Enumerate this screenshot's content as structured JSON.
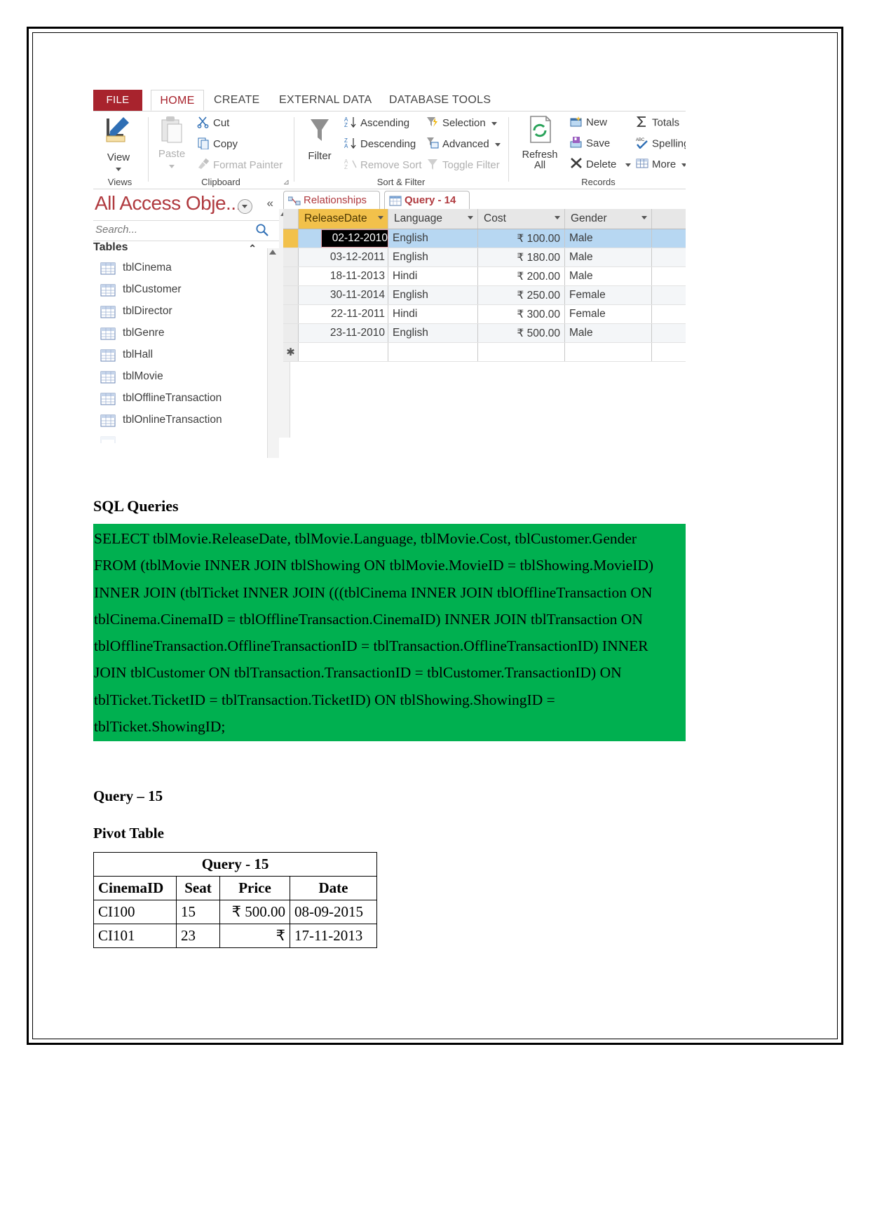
{
  "access": {
    "tabs": [
      {
        "id": "file",
        "label": "FILE"
      },
      {
        "id": "home",
        "label": "HOME"
      },
      {
        "id": "create",
        "label": "CREATE"
      },
      {
        "id": "external",
        "label": "EXTERNAL DATA"
      },
      {
        "id": "dbtools",
        "label": "DATABASE TOOLS"
      }
    ],
    "ribbon": {
      "views": {
        "group_label": "Views",
        "view_label": "View"
      },
      "clipboard": {
        "group_label": "Clipboard",
        "paste_label": "Paste",
        "cut_label": "Cut",
        "copy_label": "Copy",
        "format_painter_label": "Format Painter"
      },
      "sort_filter": {
        "group_label": "Sort & Filter",
        "filter_label": "Filter",
        "ascending_label": "Ascending",
        "descending_label": "Descending",
        "remove_sort_label": "Remove Sort",
        "selection_label": "Selection",
        "advanced_label": "Advanced",
        "toggle_filter_label": "Toggle Filter"
      },
      "records": {
        "group_label": "Records",
        "refresh_all_label": "Refresh All",
        "new_label": "New",
        "save_label": "Save",
        "delete_label": "Delete",
        "totals_label": "Totals",
        "spelling_label": "Spelling",
        "more_label": "More"
      }
    },
    "navpane": {
      "title": "All Access Obje...",
      "search_placeholder": "Search...",
      "section_label": "Tables",
      "tables": [
        "tblCinema",
        "tblCustomer",
        "tblDirector",
        "tblGenre",
        "tblHall",
        "tblMovie",
        "tblOfflineTransaction",
        "tblOnlineTransaction"
      ]
    },
    "doc_tabs": [
      {
        "id": "relationships",
        "label": "Relationships",
        "active": false
      },
      {
        "id": "query14",
        "label": "Query - 14",
        "active": true
      }
    ],
    "datasheet": {
      "columns": [
        "ReleaseDate",
        "Language",
        "Cost",
        "Gender"
      ],
      "rows": [
        {
          "ReleaseDate": "02-12-2010",
          "Language": "English",
          "Cost": "₹ 100.00",
          "Gender": "Male"
        },
        {
          "ReleaseDate": "03-12-2011",
          "Language": "English",
          "Cost": "₹ 180.00",
          "Gender": "Male"
        },
        {
          "ReleaseDate": "18-11-2013",
          "Language": "Hindi",
          "Cost": "₹ 200.00",
          "Gender": "Male"
        },
        {
          "ReleaseDate": "30-11-2014",
          "Language": "English",
          "Cost": "₹ 250.00",
          "Gender": "Female"
        },
        {
          "ReleaseDate": "22-11-2011",
          "Language": "Hindi",
          "Cost": "₹ 300.00",
          "Gender": "Female"
        },
        {
          "ReleaseDate": "23-11-2010",
          "Language": "English",
          "Cost": "₹ 500.00",
          "Gender": "Male"
        }
      ],
      "new_record_marker": "✱"
    }
  },
  "document": {
    "sql_heading": "SQL Queries",
    "sql_highlight_color": "#00b050",
    "sql_lines": [
      "SELECT tblMovie.ReleaseDate, tblMovie.Language, tblMovie.Cost, tblCustomer.Gender",
      "FROM (tblMovie INNER JOIN tblShowing ON tblMovie.MovieID = tblShowing.MovieID)",
      "INNER JOIN (tblTicket INNER JOIN (((tblCinema INNER JOIN tblOfflineTransaction ON",
      "tblCinema.CinemaID = tblOfflineTransaction.CinemaID) INNER JOIN tblTransaction ON",
      "tblOfflineTransaction.OfflineTransactionID = tblTransaction.OfflineTransactionID) INNER",
      "JOIN tblCustomer ON tblTransaction.TransactionID = tblCustomer.TransactionID) ON",
      "tblTicket.TicketID = tblTransaction.TicketID) ON tblShowing.ShowingID =",
      "tblTicket.ShowingID;"
    ],
    "query_heading": "Query – 15",
    "pivot_heading": "Pivot Table",
    "pivot_table": {
      "title": "Query - 15",
      "headers": [
        "CinemaID",
        "Seat",
        "Price",
        "Date"
      ],
      "rows": [
        {
          "CinemaID": "CI100",
          "Seat": "15",
          "Price": "₹ 500.00",
          "Date": "08-09-2015"
        },
        {
          "CinemaID": "CI101",
          "Seat": "23",
          "Price": "₹",
          "Date": "17-11-2013"
        }
      ]
    }
  }
}
